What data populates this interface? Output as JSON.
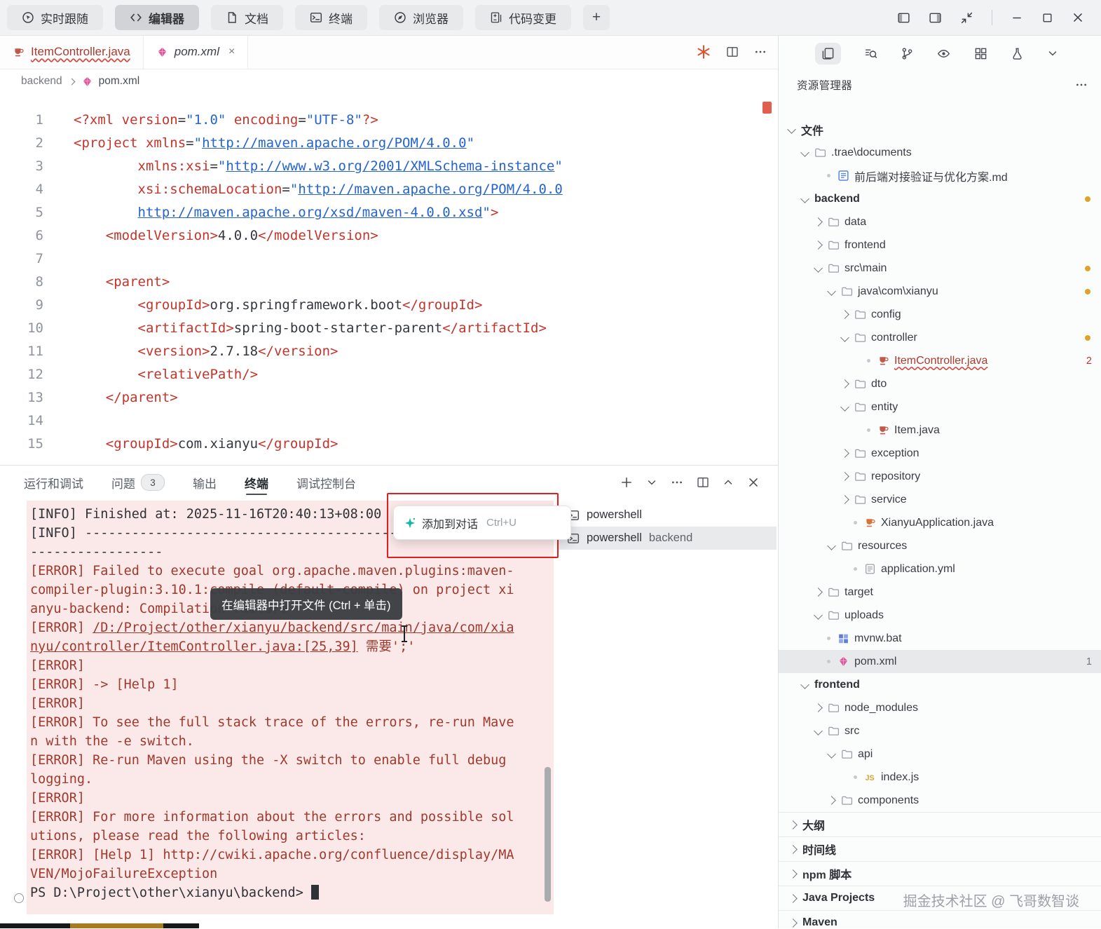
{
  "accents": {
    "annotation_red": "#e01f1f",
    "error_text": "#9e3a2d",
    "link_blue": "#2563cf",
    "modified_orange": "#dfa32a",
    "ai_teal": "#14b8a0",
    "maven_pink": "#e0569d"
  },
  "titlebar": {
    "tabs": [
      {
        "id": "follow",
        "label": "实时跟随",
        "icon": "follow-icon",
        "active": false
      },
      {
        "id": "editor",
        "label": "编辑器",
        "icon": "code-icon",
        "active": true
      },
      {
        "id": "docs",
        "label": "文档",
        "icon": "doc-icon",
        "active": false
      },
      {
        "id": "terminal",
        "label": "终端",
        "icon": "terminal-icon",
        "active": false
      },
      {
        "id": "browser",
        "label": "浏览器",
        "icon": "browser-icon",
        "active": false
      },
      {
        "id": "changes",
        "label": "代码变更",
        "icon": "diff-icon",
        "active": false
      }
    ],
    "new_tab_label": "+",
    "window_controls": [
      "layout-left-icon",
      "layout-right-icon",
      "shrink-icon",
      "divider",
      "minimize-icon",
      "maximize-icon",
      "close-icon"
    ]
  },
  "editor": {
    "tabs": [
      {
        "id": "item-controller",
        "label": "ItemController.java",
        "icon": "java-class-icon",
        "error": true,
        "active": false
      },
      {
        "id": "pom",
        "label": "pom.xml",
        "icon": "maven-icon",
        "error": false,
        "active": true,
        "close_label": "×"
      }
    ],
    "actions": [
      "ai-asterisk-icon",
      "split-editor-icon",
      "more-icon"
    ],
    "breadcrumb": {
      "root": "backend",
      "file": "pom.xml"
    },
    "code_lines": [
      {
        "n": "1",
        "t": [
          [
            "t",
            "<?xml "
          ],
          [
            "a",
            "version"
          ],
          [
            "p",
            "="
          ],
          [
            "s",
            "\"1.0\""
          ],
          [
            "p",
            " "
          ],
          [
            "a",
            "encoding"
          ],
          [
            "p",
            "="
          ],
          [
            "s",
            "\"UTF-8\""
          ],
          [
            "t",
            "?>"
          ]
        ]
      },
      {
        "n": "2",
        "t": [
          [
            "t",
            "<project "
          ],
          [
            "a",
            "xmlns"
          ],
          [
            "p",
            "="
          ],
          [
            "s",
            "\""
          ],
          [
            "u",
            "http://maven.apache.org/POM/4.0.0"
          ],
          [
            "s",
            "\""
          ]
        ]
      },
      {
        "n": "3",
        "t": [
          [
            "p",
            "        "
          ],
          [
            "a",
            "xmlns:xsi"
          ],
          [
            "p",
            "="
          ],
          [
            "s",
            "\""
          ],
          [
            "u",
            "http://www.w3.org/2001/XMLSchema-instance"
          ],
          [
            "s",
            "\""
          ]
        ]
      },
      {
        "n": "4",
        "t": [
          [
            "p",
            "        "
          ],
          [
            "a",
            "xsi:schemaLocation"
          ],
          [
            "p",
            "="
          ],
          [
            "s",
            "\""
          ],
          [
            "u",
            "http://maven.apache.org/POM/4.0.0"
          ]
        ]
      },
      {
        "n": "5",
        "t": [
          [
            "p",
            "        "
          ],
          [
            "u",
            "http://maven.apache.org/xsd/maven-4.0.0.xsd"
          ],
          [
            "s",
            "\""
          ],
          [
            "t",
            ">"
          ]
        ]
      },
      {
        "n": "6",
        "t": [
          [
            "p",
            "    "
          ],
          [
            "t",
            "<modelVersion>"
          ],
          [
            "p",
            "4.0.0"
          ],
          [
            "t",
            "</modelVersion>"
          ]
        ]
      },
      {
        "n": "7",
        "t": []
      },
      {
        "n": "8",
        "t": [
          [
            "p",
            "    "
          ],
          [
            "t",
            "<parent>"
          ]
        ]
      },
      {
        "n": "9",
        "t": [
          [
            "p",
            "        "
          ],
          [
            "t",
            "<groupId>"
          ],
          [
            "p",
            "org.springframework.boot"
          ],
          [
            "t",
            "</groupId>"
          ]
        ]
      },
      {
        "n": "10",
        "t": [
          [
            "p",
            "        "
          ],
          [
            "t",
            "<artifactId>"
          ],
          [
            "p",
            "spring-boot-starter-parent"
          ],
          [
            "t",
            "</artifactId>"
          ]
        ]
      },
      {
        "n": "11",
        "t": [
          [
            "p",
            "        "
          ],
          [
            "t",
            "<version>"
          ],
          [
            "p",
            "2.7.18"
          ],
          [
            "t",
            "</version>"
          ]
        ]
      },
      {
        "n": "12",
        "t": [
          [
            "p",
            "        "
          ],
          [
            "t",
            "<relativePath/>"
          ]
        ]
      },
      {
        "n": "13",
        "t": [
          [
            "p",
            "    "
          ],
          [
            "t",
            "</parent>"
          ]
        ]
      },
      {
        "n": "14",
        "t": []
      },
      {
        "n": "15",
        "t": [
          [
            "p",
            "    "
          ],
          [
            "t",
            "<groupId>"
          ],
          [
            "p",
            "com.xianyu"
          ],
          [
            "t",
            "</groupId>"
          ]
        ]
      }
    ]
  },
  "panel": {
    "tabs": [
      {
        "label": "运行和调试",
        "active": false
      },
      {
        "label": "问题",
        "badge": "3",
        "active": false
      },
      {
        "label": "输出",
        "active": false
      },
      {
        "label": "终端",
        "active": true
      },
      {
        "label": "调试控制台",
        "active": false
      }
    ],
    "actions": [
      "plus-icon",
      "chevron-down-icon",
      "more-icon",
      "split-editor-icon",
      "chevron-up-icon",
      "close-icon"
    ],
    "terminals": [
      {
        "label": "powershell",
        "detail": "",
        "active": false
      },
      {
        "label": "powershell",
        "detail": "backend",
        "active": true
      }
    ],
    "popup": {
      "label": "添加到对话",
      "shortcut": "Ctrl+U"
    },
    "tooltip": "在编辑器中打开文件 (Ctrl + 单击)",
    "terminal_lines": [
      {
        "t": [
          [
            "i",
            "[INFO] Finished at: 2025-11-16T20:40:13+08:00"
          ]
        ]
      },
      {
        "t": [
          [
            "i",
            "[INFO] ------------------------------------------------------------------------"
          ]
        ]
      },
      {
        "t": [
          [
            "e",
            "[ERROR] Failed to execute goal org.apache.maven.plugins:maven-compiler-plugin:3.10.1:compile (default-compile) on project xianyu-backend: Compilation failure"
          ]
        ]
      },
      {
        "t": [
          [
            "e",
            "[ERROR] "
          ],
          [
            "el",
            "/D:/Project/other/xianyu/backend/src/main/java/com/xianyu/controller/ItemController.java:[25,39]"
          ],
          [
            "e",
            " 需要';'"
          ]
        ]
      },
      {
        "t": [
          [
            "e",
            "[ERROR]"
          ]
        ]
      },
      {
        "t": [
          [
            "e",
            "[ERROR] -> [Help 1]"
          ]
        ]
      },
      {
        "t": [
          [
            "e",
            "[ERROR]"
          ]
        ]
      },
      {
        "t": [
          [
            "e",
            "[ERROR] To see the full stack trace of the errors, re-run Maven with the -e switch."
          ]
        ]
      },
      {
        "t": [
          [
            "e",
            "[ERROR] Re-run Maven using the -X switch to enable full debug logging."
          ]
        ]
      },
      {
        "t": [
          [
            "e",
            "[ERROR]"
          ]
        ]
      },
      {
        "t": [
          [
            "e",
            "[ERROR] For more information about the errors and possible solutions, please read the following articles:"
          ]
        ]
      },
      {
        "t": [
          [
            "e",
            "[ERROR] [Help 1] http://cwiki.apache.org/confluence/display/MAVEN/MojoFailureException"
          ]
        ]
      },
      {
        "t": [
          [
            "pr",
            "PS D:\\Project\\other\\xianyu\\backend> "
          ],
          [
            "cur",
            "▉"
          ]
        ]
      }
    ]
  },
  "sidebar": {
    "title": "资源管理器",
    "activity_icons": [
      "files-icon",
      "search-icon",
      "git-branch-icon",
      "debug-icon",
      "extensions-icon",
      "test-icon",
      "chevron-down-icon"
    ],
    "tree": [
      {
        "label": "文件",
        "indent": 0,
        "chev": "down",
        "bold": true
      },
      {
        "label": ".trae\\documents",
        "indent": 1,
        "chev": "down",
        "icon": "folder-icon"
      },
      {
        "label": "前后端对接验证与优化方案.md",
        "indent": 2,
        "icon": "md-icon",
        "dot": true
      },
      {
        "label": "backend",
        "indent": 1,
        "chev": "down",
        "bold": true,
        "mod": true
      },
      {
        "label": "data",
        "indent": 2,
        "chev": "right",
        "icon": "folder-icon"
      },
      {
        "label": "frontend",
        "indent": 2,
        "chev": "right",
        "icon": "folder-icon"
      },
      {
        "label": "src\\main",
        "indent": 2,
        "chev": "down",
        "icon": "folder-icon",
        "mod": true
      },
      {
        "label": "java\\com\\xianyu",
        "indent": 3,
        "chev": "down",
        "icon": "folder-icon",
        "mod": true
      },
      {
        "label": "config",
        "indent": 4,
        "chev": "right",
        "icon": "folder-icon"
      },
      {
        "label": "controller",
        "indent": 4,
        "chev": "down",
        "icon": "folder-icon",
        "mod": true
      },
      {
        "label": "ItemController.java",
        "indent": 5,
        "icon": "java-class-icon",
        "dot": true,
        "error": true,
        "badge": "2"
      },
      {
        "label": "dto",
        "indent": 4,
        "chev": "right",
        "icon": "folder-icon"
      },
      {
        "label": "entity",
        "indent": 4,
        "chev": "down",
        "icon": "folder-icon"
      },
      {
        "label": "Item.java",
        "indent": 5,
        "icon": "java-class-icon",
        "dot": true
      },
      {
        "label": "exception",
        "indent": 4,
        "chev": "right",
        "icon": "folder-icon"
      },
      {
        "label": "repository",
        "indent": 4,
        "chev": "right",
        "icon": "folder-icon"
      },
      {
        "label": "service",
        "indent": 4,
        "chev": "right",
        "icon": "folder-icon"
      },
      {
        "label": "XianyuApplication.java",
        "indent": 4,
        "icon": "java-app-icon",
        "dot": true
      },
      {
        "label": "resources",
        "indent": 3,
        "chev": "down",
        "icon": "folder-icon"
      },
      {
        "label": "application.yml",
        "indent": 4,
        "icon": "yml-icon",
        "dot": true
      },
      {
        "label": "target",
        "indent": 2,
        "chev": "right",
        "icon": "folder-icon"
      },
      {
        "label": "uploads",
        "indent": 2,
        "chev": "down",
        "icon": "folder-icon"
      },
      {
        "label": "mvnw.bat",
        "indent": 2,
        "icon": "bat-icon",
        "dot": true
      },
      {
        "label": "pom.xml",
        "indent": 2,
        "icon": "maven-icon",
        "dot": true,
        "selected": true,
        "badge": "1"
      },
      {
        "label": "frontend",
        "indent": 1,
        "chev": "down",
        "bold": true
      },
      {
        "label": "node_modules",
        "indent": 2,
        "chev": "right",
        "icon": "folder-icon"
      },
      {
        "label": "src",
        "indent": 2,
        "chev": "down",
        "icon": "folder-icon"
      },
      {
        "label": "api",
        "indent": 3,
        "chev": "down",
        "icon": "folder-icon"
      },
      {
        "label": "index.js",
        "indent": 4,
        "icon": "js-icon",
        "dot": true
      },
      {
        "label": "components",
        "indent": 3,
        "chev": "right",
        "icon": "folder-icon"
      }
    ],
    "bottom_sections": [
      {
        "label": "大纲"
      },
      {
        "label": "时间线"
      },
      {
        "label": "npm 脚本"
      },
      {
        "label": "Java Projects"
      },
      {
        "label": "Maven"
      }
    ]
  },
  "watermark": "掘金技术社区 @ 飞哥数智谈"
}
